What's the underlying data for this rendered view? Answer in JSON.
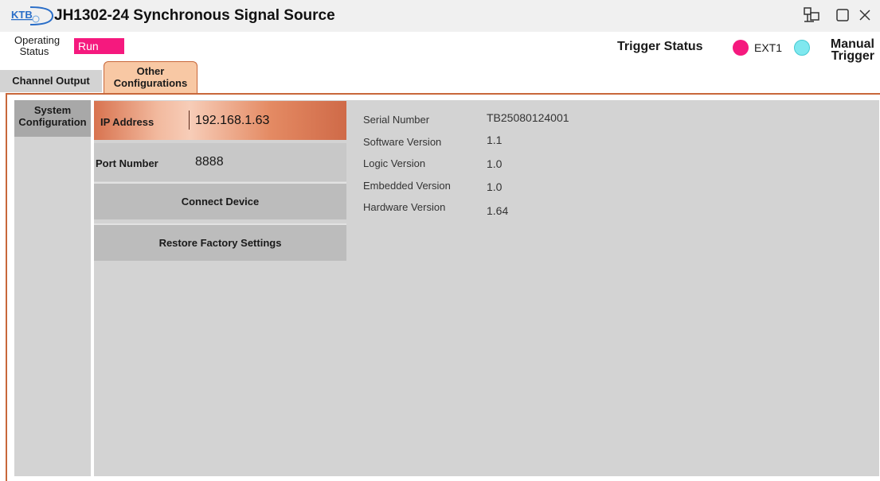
{
  "window": {
    "title": "JH1302-24 Synchronous Signal Source",
    "logo_text": "KTB"
  },
  "status": {
    "operating_label": "Operating Status",
    "run_label": "Run",
    "trigger_status_label": "Trigger Status",
    "ext1_label": "EXT1",
    "manual_trigger_label": "Manual Trigger",
    "colors": {
      "run": "#f5197e",
      "ext1": "#f5197e",
      "manual": "#7fe8ef",
      "accent": "#c8673a"
    }
  },
  "tabs": [
    {
      "label": "Channel Output",
      "active": false
    },
    {
      "label": "Other Configurations",
      "active": true
    }
  ],
  "sidebar": {
    "items": [
      {
        "label": "System Configuration",
        "active": true
      }
    ]
  },
  "config": {
    "ip_label": "IP Address",
    "ip_value": "192.168.1.63",
    "port_label": "Port Number",
    "port_value": "8888",
    "connect_label": "Connect Device",
    "restore_label": "Restore Factory Settings"
  },
  "info": [
    {
      "label": "Serial Number",
      "value": "TB25080124001"
    },
    {
      "label": "Software Version",
      "value": "1.1"
    },
    {
      "label": "Logic Version",
      "value": "1.0"
    },
    {
      "label": "Embedded Version",
      "value": "1.0"
    },
    {
      "label": "Hardware Version",
      "value": "1.64"
    }
  ],
  "icons": [
    "ktb-logo",
    "network-icon",
    "maximize-icon",
    "close-icon"
  ]
}
